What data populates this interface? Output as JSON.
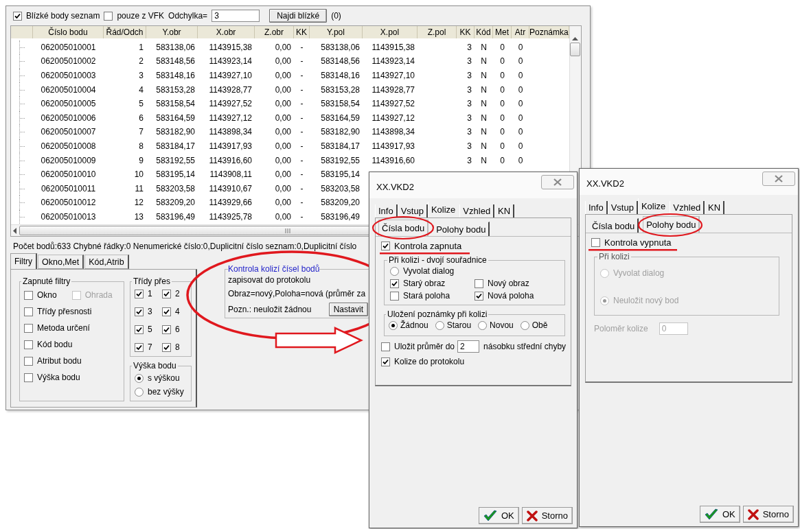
{
  "main_window": {
    "toolbar": {
      "near_points": {
        "label": "Blízké body seznam",
        "checked": true
      },
      "vfk_only": {
        "label": "pouze z VFK",
        "checked": false
      },
      "deviation_label": "Odchylka=",
      "deviation_value": "3",
      "find_button": "Najdi blízké",
      "count": "(0)"
    },
    "table": {
      "columns": [
        "Číslo bodu",
        "Řád/Odch",
        "Y.obr",
        "X.obr",
        "Z.obr",
        "KK",
        "Y.pol",
        "X.pol",
        "Z.pol",
        "KK",
        "Kód",
        "Met",
        "Atr",
        "Poznámka"
      ],
      "rows": [
        {
          "cells": [
            "062005010001",
            "1",
            "583138,06",
            "1143915,38",
            "0,00",
            "-",
            "583138,06",
            "1143915,38",
            "",
            "3",
            "N",
            "0",
            "0"
          ]
        },
        {
          "cells": [
            "062005010002",
            "2",
            "583148,56",
            "1143923,14",
            "0,00",
            "-",
            "583148,56",
            "1143923,14",
            "",
            "3",
            "N",
            "0",
            "0"
          ]
        },
        {
          "cells": [
            "062005010003",
            "3",
            "583148,16",
            "1143927,10",
            "0,00",
            "-",
            "583148,16",
            "1143927,10",
            "",
            "3",
            "N",
            "0",
            "0"
          ]
        },
        {
          "cells": [
            "062005010004",
            "4",
            "583153,28",
            "1143928,77",
            "0,00",
            "-",
            "583153,28",
            "1143928,77",
            "",
            "3",
            "N",
            "0",
            "0"
          ]
        },
        {
          "cells": [
            "062005010005",
            "5",
            "583158,54",
            "1143927,52",
            "0,00",
            "-",
            "583158,54",
            "1143927,52",
            "",
            "3",
            "N",
            "0",
            "0"
          ]
        },
        {
          "cells": [
            "062005010006",
            "6",
            "583164,59",
            "1143927,12",
            "0,00",
            "-",
            "583164,59",
            "1143927,12",
            "",
            "3",
            "N",
            "0",
            "0"
          ]
        },
        {
          "cells": [
            "062005010007",
            "7",
            "583182,90",
            "1143898,34",
            "0,00",
            "-",
            "583182,90",
            "1143898,34",
            "",
            "3",
            "N",
            "0",
            "0"
          ]
        },
        {
          "cells": [
            "062005010008",
            "8",
            "583184,17",
            "1143917,93",
            "0,00",
            "-",
            "583184,17",
            "1143917,93",
            "",
            "3",
            "N",
            "0",
            "0"
          ]
        },
        {
          "cells": [
            "062005010009",
            "9",
            "583192,55",
            "1143916,60",
            "0,00",
            "-",
            "583192,55",
            "1143916,60",
            "",
            "3",
            "N",
            "0",
            "0"
          ]
        },
        {
          "cells": [
            "062005010010",
            "10",
            "583195,14",
            "1143908,11",
            "0,00",
            "-",
            "583195,14"
          ]
        },
        {
          "cells": [
            "062005010011",
            "11",
            "583203,58",
            "1143910,67",
            "0,00",
            "-",
            "583203,58"
          ]
        },
        {
          "cells": [
            "062005010012",
            "12",
            "583209,20",
            "1143929,66",
            "0,00",
            "-",
            "583209,20"
          ]
        },
        {
          "cells": [
            "062005010013",
            "13",
            "583196,49",
            "1143925,78",
            "0,00",
            "-",
            "583196,49"
          ]
        }
      ]
    },
    "status_bar": "Počet bodů:633  Chybné řádky:0  Nenumerické číslo:0,Duplicitní číslo seznam:0,Duplicitní číslo",
    "tabs": [
      {
        "label": "Filtry",
        "selected": true
      },
      {
        "label": "Okno,Met",
        "selected": false
      },
      {
        "label": "Kód,Atrib",
        "selected": false
      }
    ],
    "filters": {
      "title": "Zapnuté filtry",
      "rows": [
        {
          "items": [
            {
              "label": "Okno",
              "checked": false,
              "disabled": false
            },
            {
              "label": "Ohrada",
              "checked": false,
              "disabled": true
            }
          ]
        },
        {
          "items": [
            {
              "label": "Třídy přesnosti",
              "checked": false,
              "disabled": false
            }
          ]
        },
        {
          "items": [
            {
              "label": "Metoda určení",
              "checked": false,
              "disabled": false
            }
          ]
        },
        {
          "items": [
            {
              "label": "Kód bodu",
              "checked": false,
              "disabled": false
            }
          ]
        },
        {
          "items": [
            {
              "label": "Atribut bodu",
              "checked": false,
              "disabled": false
            }
          ]
        },
        {
          "items": [
            {
              "label": "Výška bodu",
              "checked": false,
              "disabled": false
            }
          ]
        }
      ]
    },
    "classes": {
      "title": "Třídy přes",
      "items": [
        {
          "label": "1",
          "checked": true
        },
        {
          "label": "2",
          "checked": true
        },
        {
          "label": "3",
          "checked": true
        },
        {
          "label": "4",
          "checked": true
        },
        {
          "label": "5",
          "checked": true
        },
        {
          "label": "6",
          "checked": true
        },
        {
          "label": "7",
          "checked": true
        },
        {
          "label": "8",
          "checked": true
        }
      ]
    },
    "height": {
      "title": "Výška bodu",
      "options": [
        {
          "label": "s výškou",
          "selected": true
        },
        {
          "label": "bez výšky",
          "selected": false
        }
      ]
    },
    "collision_summary": {
      "title": "Kontrola kolizí čísel bodů",
      "lines": [
        "zapisovat do protokolu",
        "Obraz=nový,Poloha=nová (průměr za"
      ],
      "note": "Pozn.: neuložit žádnou",
      "button": "Nastavit"
    }
  },
  "dialogs": [
    {
      "kind": "numbers",
      "title": "XX.VKD2",
      "tabs": [
        {
          "label": "Info",
          "selected": false
        },
        {
          "label": "Vstup",
          "selected": false
        },
        {
          "label": "Kolize",
          "selected": true
        },
        {
          "label": "Vzhled",
          "selected": false
        },
        {
          "label": "KN",
          "selected": false
        }
      ],
      "subtabs": [
        {
          "label": "Čísla bodu",
          "selected": true
        },
        {
          "label": "Polohy bodu",
          "selected": false
        }
      ],
      "master": {
        "label": "Kontrola zapnuta",
        "checked": true
      },
      "collision_group": {
        "title": "Při kolizi - dvojí souřadnice",
        "radio": {
          "label": "Vyvolat dialog",
          "selected": false
        },
        "checks": [
          {
            "label": "Starý obraz",
            "checked": true
          },
          {
            "label": "Nový obraz",
            "checked": false
          },
          {
            "label": "Stará poloha",
            "checked": false
          },
          {
            "label": "Nová poloha",
            "checked": true
          }
        ]
      },
      "note_group": {
        "title": "Uložení poznámky při kolizi",
        "options": [
          {
            "label": "Žádnou",
            "selected": true
          },
          {
            "label": "Starou",
            "selected": false
          },
          {
            "label": "Novou",
            "selected": false
          },
          {
            "label": "Obě",
            "selected": false
          }
        ]
      },
      "average": {
        "label": "Uložit průměr do",
        "checked": false,
        "value": "2",
        "suffix": "násobku střední chyby"
      },
      "protocol": {
        "label": "Kolize do protokolu",
        "checked": true
      },
      "buttons": [
        {
          "kind": "ok",
          "label": "OK"
        },
        {
          "kind": "cancel",
          "label": "Storno"
        }
      ]
    },
    {
      "kind": "positions",
      "title": "XX.VKD2",
      "tabs": [
        {
          "label": "Info",
          "selected": false
        },
        {
          "label": "Vstup",
          "selected": false
        },
        {
          "label": "Kolize",
          "selected": true
        },
        {
          "label": "Vzhled",
          "selected": false
        },
        {
          "label": "KN",
          "selected": false
        }
      ],
      "subtabs": [
        {
          "label": "Čísla bodu",
          "selected": false
        },
        {
          "label": "Polohy bodu",
          "selected": true
        }
      ],
      "master": {
        "label": "Kontrola vypnuta",
        "checked": false
      },
      "collision_group": {
        "title": "Při kolizi",
        "disabled": true,
        "options": [
          {
            "label": "Vyvolat dialog",
            "selected": false
          },
          {
            "label": "Neuložit nový bod",
            "selected": true
          }
        ]
      },
      "radius": {
        "label": "Poloměr kolize",
        "value": "0",
        "disabled": true
      },
      "buttons": [
        {
          "kind": "ok",
          "label": "OK"
        },
        {
          "kind": "cancel",
          "label": "Storno"
        }
      ]
    }
  ]
}
